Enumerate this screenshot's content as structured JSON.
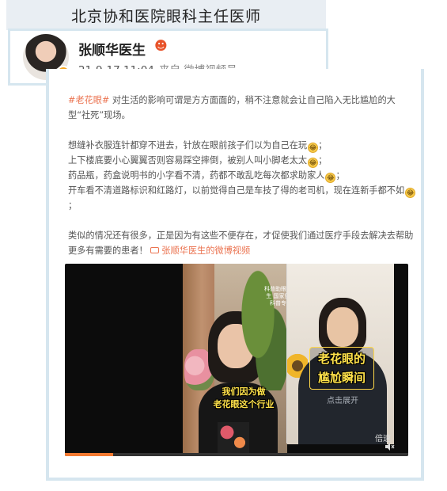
{
  "banner": {
    "title": "北京协和医院眼科主任医师"
  },
  "profile": {
    "name": "张顺华医生",
    "badge": "☻",
    "time": "21-9-17 11:04",
    "source": "来自 微博视频号"
  },
  "post": {
    "p1_hashtag": "#老花眼#",
    "p1_text": " 对生活的影响可谓是方方面面的，稍不注意就会让自己陷入无比尴尬的大型“社死”现场。",
    "lines": [
      "想缝补衣服连针都穿不进去，针放在眼前孩子们以为自己在玩",
      "上下楼底要小心翼翼否则容易踩空摔倒，被别人叫小脚老太太",
      "药品瓶，药盒说明书的小字看不清，药都不敢乱吃每次都求助家人",
      "开车看不清道路标识和红路灯，以前觉得自己是车技了得的老司机，现在连新手都不如"
    ],
    "p3_text": "类似的情况还有很多，正是因为有这些不便存在，才促使我们通过医疗手段去解决去帮助更多有需要的患者！",
    "video_link": "张顺华医生的微博视频"
  },
  "video": {
    "subtitle": "我们因为做\n老花眼这个行业",
    "vertical_caption": "科普助眼新医生 国家健康科普专家",
    "small_caption": "",
    "badge_title": "老花眼的\n尴尬瞬间",
    "expand_label": "点击展开",
    "speed_label": "倍速",
    "progress": 0.14
  },
  "icons": {
    "emoji": "laugh-cry-emoji",
    "verify": "verified-badge",
    "video": "video-camera-icon",
    "mute": "speaker-icon"
  },
  "colors": {
    "accent": "#eb7350",
    "card_border": "#d6e6ef",
    "subtitle": "#ffe24a",
    "progress": "#f47a31"
  }
}
